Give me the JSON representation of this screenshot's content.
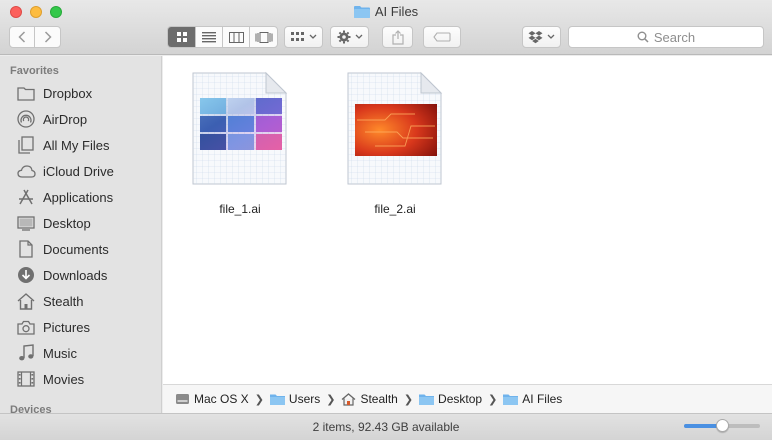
{
  "window": {
    "title": "AI Files",
    "traffic_lights": {
      "close": "#fc605c",
      "minimize": "#fdbc40",
      "maximize": "#34c84a"
    }
  },
  "toolbar": {
    "back_icon": "chevron-left-icon",
    "forward_icon": "chevron-right-icon",
    "view_modes": [
      "icon-view",
      "list-view",
      "column-view",
      "cover-flow-view"
    ],
    "active_view": "icon-view",
    "search_placeholder": "Search"
  },
  "sidebar": {
    "sections": [
      {
        "heading": "Favorites",
        "items": [
          {
            "label": "Dropbox",
            "icon": "dropbox-folder-icon"
          },
          {
            "label": "AirDrop",
            "icon": "airdrop-icon"
          },
          {
            "label": "All My Files",
            "icon": "all-files-icon"
          },
          {
            "label": "iCloud Drive",
            "icon": "cloud-icon"
          },
          {
            "label": "Applications",
            "icon": "applications-icon"
          },
          {
            "label": "Desktop",
            "icon": "desktop-icon"
          },
          {
            "label": "Documents",
            "icon": "documents-icon"
          },
          {
            "label": "Downloads",
            "icon": "downloads-icon"
          },
          {
            "label": "Stealth",
            "icon": "home-icon"
          },
          {
            "label": "Pictures",
            "icon": "camera-icon"
          },
          {
            "label": "Music",
            "icon": "music-icon"
          },
          {
            "label": "Movies",
            "icon": "movies-icon"
          }
        ]
      },
      {
        "heading": "Devices",
        "items": []
      }
    ]
  },
  "files": [
    {
      "name": "file_1.ai",
      "thumbnail": "grid-of-blue-purple-thumbnails"
    },
    {
      "name": "file_2.ai",
      "thumbnail": "red-orange-circuit-image"
    }
  ],
  "pathbar": [
    {
      "label": "Mac OS X",
      "icon": "hard-drive-icon"
    },
    {
      "label": "Users",
      "icon": "folder-icon"
    },
    {
      "label": "Stealth",
      "icon": "home-icon"
    },
    {
      "label": "Desktop",
      "icon": "folder-icon"
    },
    {
      "label": "AI Files",
      "icon": "folder-icon"
    }
  ],
  "status": {
    "text": "2 items, 92.43 GB available",
    "icon_size_fraction": 0.5
  },
  "colors": {
    "accent": "#4a90e2",
    "folder_blue": "#6fb3ec"
  }
}
